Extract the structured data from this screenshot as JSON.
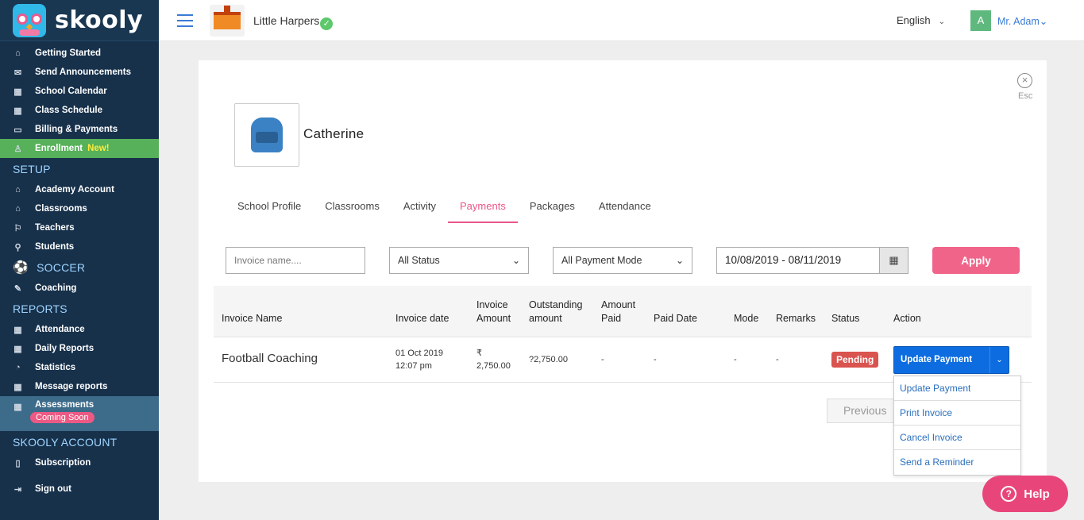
{
  "brand": {
    "name": "skooly"
  },
  "sidebar": {
    "items_top": [
      {
        "label": "Getting Started",
        "icon": "home-icon",
        "glyph": "⌂"
      },
      {
        "label": "Send Announcements",
        "icon": "megaphone-icon",
        "glyph": "✉"
      },
      {
        "label": "School Calendar",
        "icon": "calendar-icon",
        "glyph": "▦"
      },
      {
        "label": "Class Schedule",
        "icon": "schedule-icon",
        "glyph": "▦"
      },
      {
        "label": "Billing & Payments",
        "icon": "billing-icon",
        "glyph": "▭"
      }
    ],
    "enrollment": {
      "label": "Enrollment",
      "badge": "New!",
      "glyph": "♙"
    },
    "setup": {
      "title": "SETUP",
      "items": [
        {
          "label": "Academy Account",
          "glyph": "⌂"
        },
        {
          "label": "Classrooms",
          "glyph": "⌂"
        },
        {
          "label": "Teachers",
          "glyph": "⚐"
        },
        {
          "label": "Students",
          "glyph": "⚲"
        }
      ]
    },
    "soccer": {
      "title": "SOCCER",
      "glyph": "⚽",
      "items": [
        {
          "label": "Coaching",
          "glyph": "✎"
        }
      ]
    },
    "reports": {
      "title": "REPORTS",
      "items": [
        {
          "label": "Attendance",
          "glyph": "▦"
        },
        {
          "label": "Daily Reports",
          "glyph": "▦"
        },
        {
          "label": "Statistics",
          "glyph": "◔"
        },
        {
          "label": "Message reports",
          "glyph": "▦"
        }
      ]
    },
    "assessments": {
      "label": "Assessments",
      "badge": "Coming Soon",
      "glyph": "▦"
    },
    "account": {
      "title": "SKOOLY ACCOUNT",
      "items": [
        {
          "label": "Subscription",
          "glyph": "▯"
        }
      ]
    },
    "signout": {
      "label": "Sign out",
      "glyph": "⇥"
    }
  },
  "topbar": {
    "school_name": "Little Harpers",
    "verified_glyph": "✓",
    "language": "English",
    "chevron": "⌄",
    "avatar_letter": "A",
    "user_name": "Mr. Adam",
    "user_chevron": "⌄"
  },
  "dialog": {
    "close_glyph": "×",
    "esc_label": "Esc",
    "student_name": "Catherine",
    "tabs": [
      "School Profile",
      "Classrooms",
      "Activity",
      "Payments",
      "Packages",
      "Attendance"
    ],
    "active_tab": "Payments"
  },
  "filters": {
    "invoice_placeholder": "Invoice name....",
    "status": "All Status",
    "payment_mode": "All Payment Mode",
    "date_range": "10/08/2019 - 08/11/2019",
    "calendar_glyph": "▦",
    "dropdown_glyph": "⌄",
    "apply_label": "Apply"
  },
  "table": {
    "headers": {
      "invoice_name": "Invoice Name",
      "invoice_date": "Invoice date",
      "invoice_amount_1": "Invoice",
      "invoice_amount_2": "Amount",
      "outstanding_1": "Outstanding",
      "outstanding_2": "amount",
      "amount_paid_1": "Amount",
      "amount_paid_2": "Paid",
      "paid_date": "Paid Date",
      "mode": "Mode",
      "remarks": "Remarks",
      "status": "Status",
      "action": "Action"
    },
    "rows": [
      {
        "invoice_name": "Football Coaching",
        "date_line1": "01 Oct 2019",
        "date_line2": "12:07 pm",
        "amount_line1": "₹",
        "amount_line2": "2,750.00",
        "outstanding": "?2,750.00",
        "amount_paid": "-",
        "paid_date": "-",
        "mode": "-",
        "remarks": "-",
        "status": "Pending",
        "action": "Update Payment",
        "split_glyph": "⌄"
      }
    ]
  },
  "action_menu": [
    "Update Payment",
    "Print Invoice",
    "Cancel Invoice",
    "Send a Reminder"
  ],
  "pagination": {
    "previous": "Previous"
  },
  "help": {
    "label": "Help",
    "glyph": "?"
  },
  "colors": {
    "sidebar_bg": "#17314b",
    "accent_pink": "#e8578a",
    "primary_blue": "#0d6de0",
    "enroll_green": "#57b05a",
    "pending_red": "#d9534f"
  }
}
